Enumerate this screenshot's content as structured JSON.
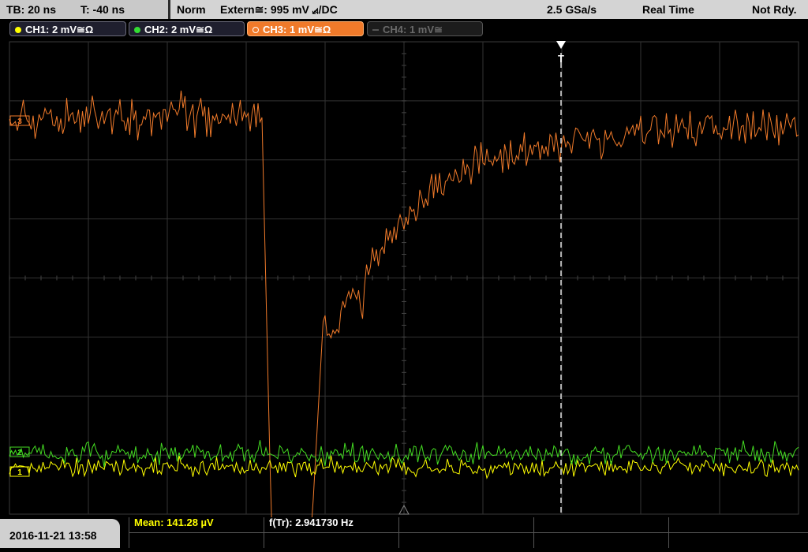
{
  "status": {
    "timebase": "TB: 20 ns",
    "trigger_time": "T: -40 ns",
    "mode": "Norm",
    "trigger_source": "Extern≅: 995 mV ⦯/DC",
    "sample_rate": "2.5 GSa/s",
    "acq_mode": "Real Time",
    "state": "Not Rdy."
  },
  "channels": [
    {
      "label": "CH1: 2 mV≅Ω",
      "color": "#ffff00"
    },
    {
      "label": "CH2: 2 mV≅Ω",
      "color": "#33dd33"
    },
    {
      "label": "CH3: 1 mV≅Ω",
      "color": "#f07a2a"
    },
    {
      "label": "CH4: 1 mV≅",
      "color": "#6a6a6a"
    }
  ],
  "channel_markers": {
    "ch3": "3",
    "ch2": "2",
    "ch1": "1"
  },
  "trigger_marker": "T",
  "datetime": "2016-11-21 13:58",
  "measurements": {
    "mean": "Mean: 141.28 µV",
    "freq": "f(Tr): 2.941730 Hz"
  },
  "colors": {
    "grid": "#3a3a3a",
    "trigger_line": "#ffffff"
  }
}
